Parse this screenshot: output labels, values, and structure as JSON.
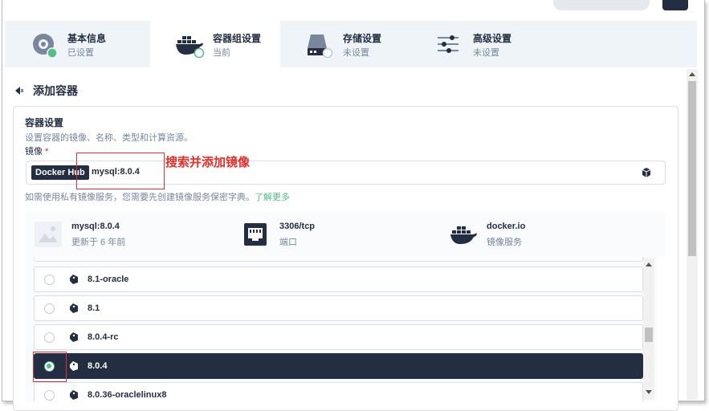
{
  "steps": [
    {
      "title": "基本信息",
      "status": "已设置",
      "icon": "gear-disk-icon"
    },
    {
      "title": "容器组设置",
      "status": "当前",
      "icon": "docker-icon"
    },
    {
      "title": "存储设置",
      "status": "未设置",
      "icon": "storage-icon"
    },
    {
      "title": "高级设置",
      "status": "未设置",
      "icon": "sliders-icon"
    }
  ],
  "header": {
    "back_title": "添加容器"
  },
  "container_settings": {
    "title": "容器设置",
    "description": "设置容器的镜像、名称、类型和计算资源。",
    "image_label": "镜像",
    "required_mark": "*",
    "registry_tag": "Docker Hub",
    "image_value": "mysql:8.0.4",
    "hint_text": "如需使用私有镜像服务，您需要先创建镜像服务保密字典。",
    "hint_link": "了解更多"
  },
  "annotation": {
    "text": "搜索并添加镜像"
  },
  "image_info": {
    "name": "mysql:8.0.4",
    "updated": "更新于 6 年前",
    "port": "3306/tcp",
    "port_label": "端口",
    "registry": "docker.io",
    "registry_label": "镜像服务"
  },
  "tags": [
    {
      "name": "8.1-oracle",
      "selected": false
    },
    {
      "name": "8.1",
      "selected": false
    },
    {
      "name": "8.0.4-rc",
      "selected": false
    },
    {
      "name": "8.0.4",
      "selected": true
    },
    {
      "name": "8.0.36-oraclelinux8",
      "selected": false
    }
  ],
  "colors": {
    "accent": "#55bc8a",
    "dark": "#242e42",
    "annotation": "#e0302a"
  }
}
